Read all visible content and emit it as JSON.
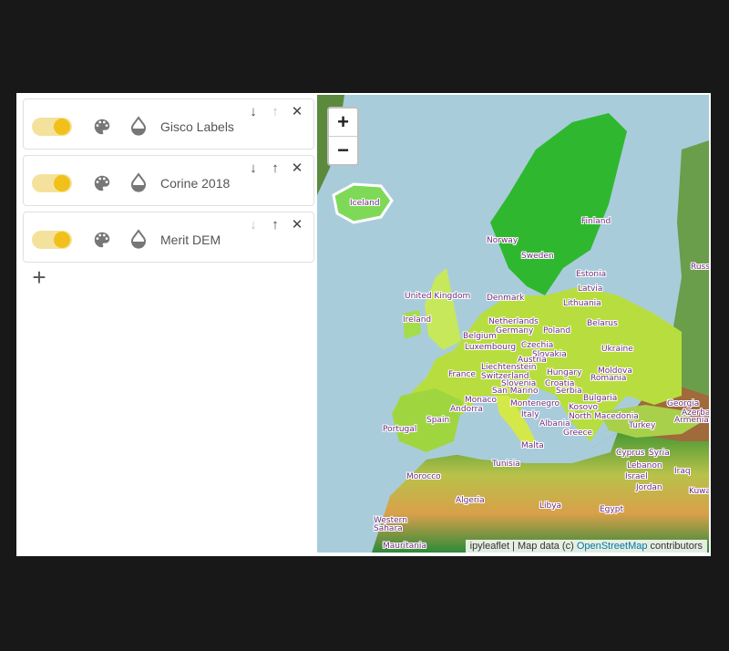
{
  "layers": [
    {
      "name": "Gisco Labels",
      "visible": true
    },
    {
      "name": "Corine 2018",
      "visible": true
    },
    {
      "name": "Merit DEM",
      "visible": true
    }
  ],
  "icons": {
    "palette": "palette-icon",
    "opacity": "opacity-icon",
    "down": "arrow-down-icon",
    "up": "arrow-up-icon",
    "remove": "close-icon",
    "add": "add-icon"
  },
  "glyphs": {
    "down": "↓",
    "up": "↑",
    "remove": "✕",
    "add": "+"
  },
  "zoom": {
    "in": "+",
    "out": "−"
  },
  "attribution": {
    "prefix": "ipyleaflet | Map data (c) ",
    "link": "OpenStreetMap",
    "suffix": " contributors"
  },
  "countries": [
    "Iceland",
    "Norway",
    "Sweden",
    "Finland",
    "Russ",
    "Estonia",
    "Latvia",
    "Lithuania",
    "Denmark",
    "United Kingdom",
    "Ireland",
    "Netherlands",
    "Germany",
    "Poland",
    "Belarus",
    "Belgium",
    "Luxembourg",
    "Czechia",
    "Ukraine",
    "Slovakia",
    "Austria",
    "Liechtenstein",
    "France",
    "Switzerland",
    "Hungary",
    "Moldova",
    "Slovenia",
    "Romania",
    "Croatia",
    "San Marino",
    "Serbia",
    "Monaco",
    "Bulgaria",
    "Andorra",
    "Montenegro",
    "Kosovo",
    "Georgia",
    "Azerba",
    "Armenia",
    "Italy",
    "North Macedonia",
    "Portugal",
    "Spain",
    "Albania",
    "Turkey",
    "Greece",
    "Malta",
    "Cyprus",
    "Syria",
    "Tunisia",
    "Lebanon",
    "Iraq",
    "Morocco",
    "Israel",
    "Jordan",
    "Kuwa",
    "Algeria",
    "Libya",
    "Egypt",
    "Western",
    "Sahara",
    "Mauritania"
  ],
  "colors": {
    "accent": "#f2c01a",
    "accent_track": "#f4e29c",
    "label": "#6b2c7a",
    "link": "#0078a8"
  }
}
